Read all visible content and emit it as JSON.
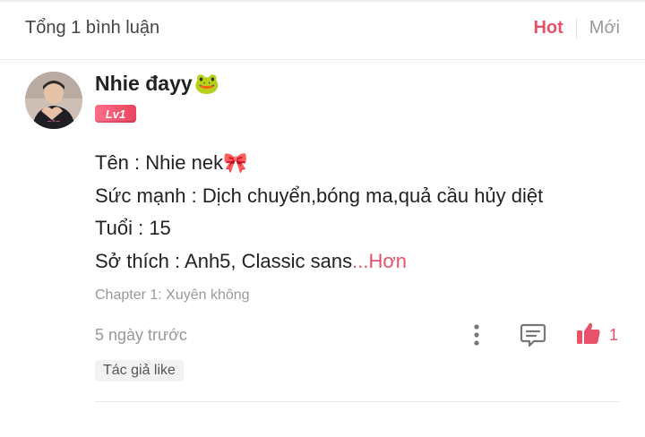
{
  "header": {
    "total_label": "Tổng 1 bình luận",
    "sort_hot": "Hot",
    "sort_new": "Mới"
  },
  "comment": {
    "username": "Nhie đayy",
    "username_emoji": "🐸",
    "level_badge": "Lv1",
    "lines": [
      "Tên : Nhie nek🎀",
      "Sức mạnh : Dịch chuyển,bóng ma,quả cầu hủy diệt",
      "Tuổi : 15",
      "Sở thích : Anh5, Classic sans"
    ],
    "more_label": "...Hơn",
    "chapter": "Chapter 1: Xuyên không",
    "time": "5 ngày trước",
    "like_count": "1",
    "author_like_tag": "Tác giả like"
  },
  "colors": {
    "accent": "#e8516a",
    "muted": "#999999"
  },
  "icons": {
    "more": "kebab-icon",
    "reply": "comment-icon",
    "like": "thumbs-up-icon"
  }
}
